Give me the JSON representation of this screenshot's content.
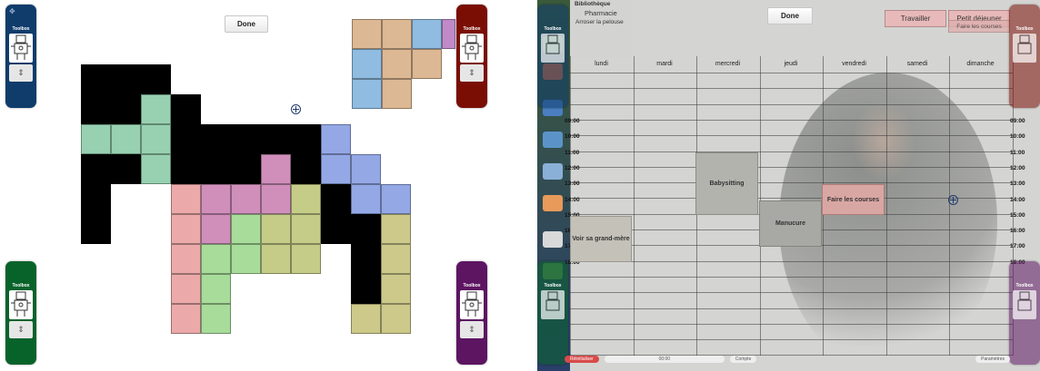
{
  "left": {
    "toolbox_label": "Toolbox",
    "done_label": "Done",
    "colors": {
      "navy": "#0f3c6b",
      "darkred": "#7a0e05",
      "green": "#08632b",
      "purple": "#5d1562"
    }
  },
  "right": {
    "toolbox_label": "Toolbox",
    "done_label": "Done",
    "btn_travailler": "Travailler",
    "btn_petit_dejeuner": "Petit déjeuner",
    "btn_faire_courses_top": "Faire les courses",
    "top_list": [
      "Bibliothèque",
      "Pharmacie",
      "Arroser la pelouse"
    ],
    "days": [
      "lundi",
      "mardi",
      "mercredi",
      "jeudi",
      "vendredi",
      "samedi",
      "dimanche"
    ],
    "times": [
      "09:00",
      "10:00",
      "11:00",
      "12:00",
      "13:00",
      "14:00",
      "15:00",
      "16:00",
      "17:00",
      "18:00"
    ],
    "events": {
      "babysitting": "Babysitting",
      "faire_courses": "Faire les courses",
      "manucure": "Manucure",
      "grand_mere": "Voir sa grand-mère"
    },
    "bottom_bar": {
      "red": "Réinitialiser",
      "field": "00:00",
      "compte": "Compte",
      "params": "Paramètres"
    }
  }
}
